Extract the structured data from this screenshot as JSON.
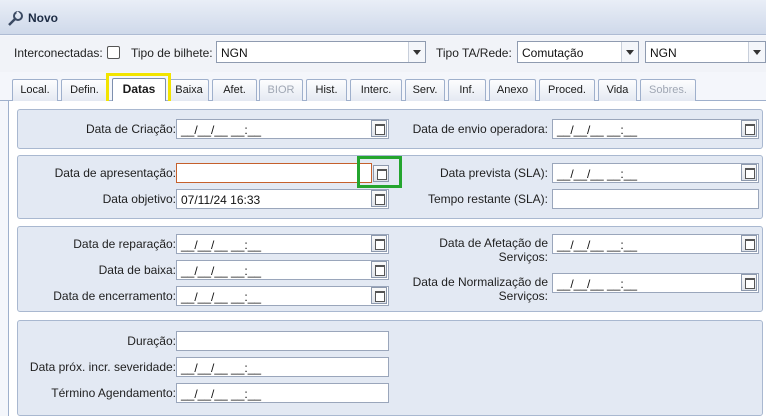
{
  "window": {
    "title": "Novo"
  },
  "header": {
    "interconectadas_label": "Interconectadas:",
    "tipo_bilhete_label": "Tipo de bilhete:",
    "tipo_bilhete_value": "NGN",
    "tipo_ta_rede_label": "Tipo TA/Rede:",
    "tipo_ta_rede_value": "Comutação",
    "rede_value": "NGN"
  },
  "tabs": [
    "Local.",
    "Defin.",
    "Datas",
    "Baixa",
    "Afet.",
    "BIOR",
    "Hist.",
    "Interc.",
    "Serv.",
    "Inf.",
    "Anexo",
    "Proced.",
    "Vida",
    "Sobres."
  ],
  "active_tab": "Datas",
  "disabled_tabs": [
    "BIOR",
    "Sobres."
  ],
  "panel1": {
    "data_criacao_label": "Data de Criação:",
    "data_criacao_value": "__/__/__ __:__",
    "data_envio_label": "Data de envio operadora:",
    "data_envio_value": "__/__/__ __:__"
  },
  "panel2": {
    "data_apresentacao_label": "Data de apresentação:",
    "data_apresentacao_value": "",
    "data_objetivo_label": "Data objetivo:",
    "data_objetivo_value": "07/11/24 16:33",
    "data_prevista_label": "Data prevista (SLA):",
    "data_prevista_value": "__/__/__ __:__",
    "tempo_restante_label": "Tempo restante (SLA):",
    "tempo_restante_value": ""
  },
  "panel3": {
    "data_reparacao_label": "Data de reparação:",
    "data_reparacao_value": "__/__/__ __:__",
    "data_baixa_label": "Data de baixa:",
    "data_baixa_value": "__/__/__ __:__",
    "data_encerramento_label": "Data de encerramento:",
    "data_encerramento_value": "__/__/__ __:__",
    "data_afetacao_label_1": "Data de Afetação de",
    "data_afetacao_label_2": "Serviços:",
    "data_afetacao_value": "__/__/__ __:__",
    "data_normalizacao_label_1": "Data de Normalização de",
    "data_normalizacao_label_2": "Serviços:",
    "data_normalizacao_value": "__/__/__ __:__"
  },
  "panel4": {
    "duracao_label": "Duração:",
    "duracao_value": "",
    "data_prox_label": "Data próx. incr. severidade:",
    "data_prox_value": "__/__/__ __:__",
    "termino_label": "Término Agendamento:",
    "termino_value": "__/__/__ __:__"
  },
  "colors": {
    "highlight_yellow": "#f2e400",
    "highlight_green": "#24a52e",
    "error_border": "#c5602c"
  }
}
